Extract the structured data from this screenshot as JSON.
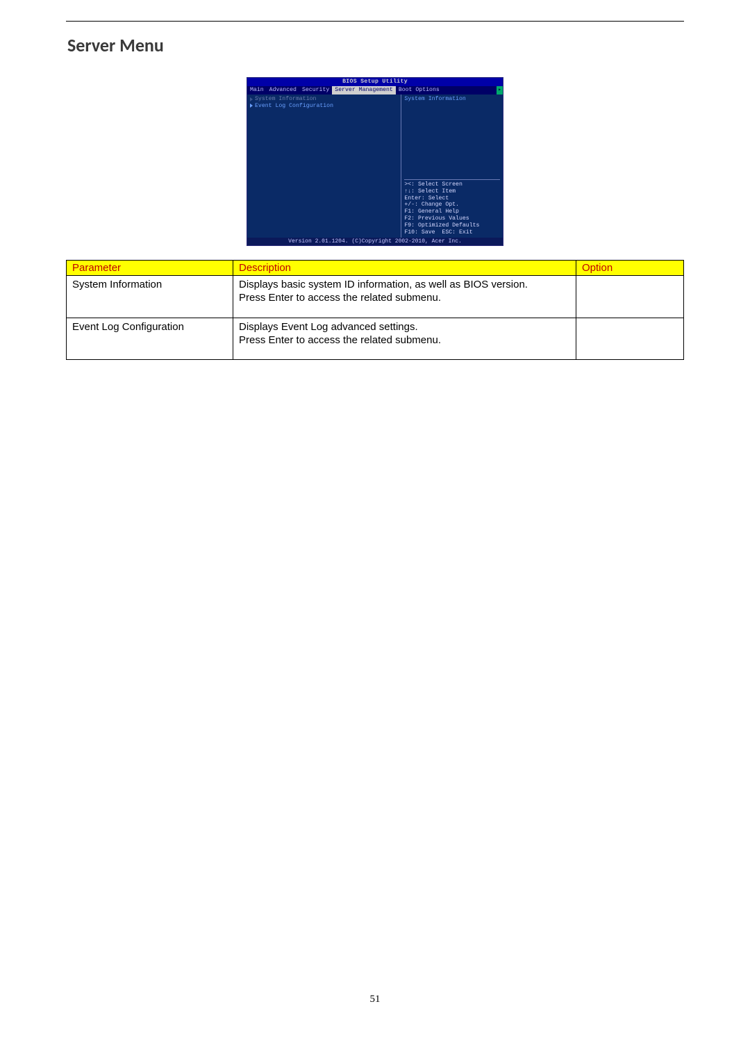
{
  "section_title": "Server Menu",
  "page_number": "51",
  "bios": {
    "title": "BIOS Setup Utility",
    "menu": [
      "Main",
      "Advanced",
      "Security",
      "Server Management",
      "Boot Options"
    ],
    "menu_selected_index": 3,
    "left_items": [
      {
        "label": "System Information",
        "selected": true
      },
      {
        "label": "Event Log Configuration",
        "selected": false
      }
    ],
    "right_heading": "System Information",
    "hints": [
      "><: Select Screen",
      "↑↓: Select Item",
      "Enter: Select",
      "+/-: Change Opt.",
      "F1: General Help",
      "F2: Previous Values",
      "F9: Optimized Defaults",
      "F10: Save  ESC: Exit"
    ],
    "footer": "Version 2.01.1204. (C)Copyright 2002-2010, Acer Inc."
  },
  "table": {
    "headers": {
      "parameter": "Parameter",
      "description": "Description",
      "option": "Option"
    },
    "rows": [
      {
        "parameter": "System Information",
        "description": "Displays basic system ID information, as well as BIOS version.\nPress Enter to access the related submenu.",
        "option": ""
      },
      {
        "parameter": "Event Log Configuration",
        "description": "Displays Event Log advanced settings.\nPress Enter to access the related submenu.",
        "option": ""
      }
    ]
  }
}
